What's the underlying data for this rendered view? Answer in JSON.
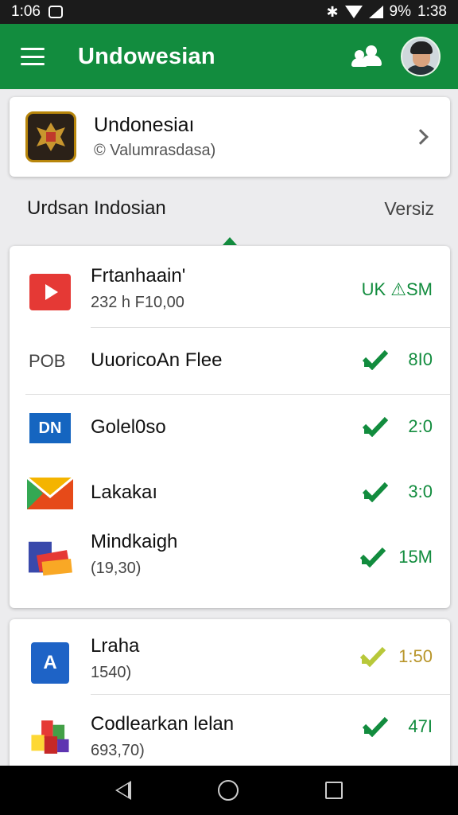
{
  "status_bar": {
    "left_text": "1:06",
    "battery": "9%",
    "time": "1:38"
  },
  "app_bar": {
    "title": "Undowesian",
    "menu_icon": "hamburger-icon",
    "people_icon": "people-icon"
  },
  "header_card": {
    "title": "Undonesiaı",
    "subtitle": "© Valumrasdasa)"
  },
  "section": {
    "title": "Urdsan Indosian",
    "action": "Versiz"
  },
  "list": [
    {
      "name": "Frtanhaain'",
      "meta": "232 h F10,00",
      "value": "UK ⚠SM",
      "icon": "play-icon",
      "checked": false
    },
    {
      "name": "UuoricoAn Flee",
      "meta": "",
      "value": "8I0",
      "icon_text": "POB",
      "checked": true
    },
    {
      "name": "Golel0so",
      "meta": "",
      "value": "2:0",
      "icon_text": "DN",
      "checked": true
    },
    {
      "name": "Lakakaı",
      "meta": "",
      "value": "3:0",
      "icon": "mail-icon",
      "checked": true
    },
    {
      "name": "Mindkaigh",
      "meta": "(19,30)",
      "value": "15M",
      "icon": "books-icon",
      "checked": true
    }
  ],
  "list2": [
    {
      "name": "Lraha",
      "meta": "1540)",
      "value": "1:50",
      "icon_text": "A",
      "checked": true,
      "check_color": "#b8c83a",
      "value_color": "#b8952a"
    },
    {
      "name": "Codlearkan lelan",
      "meta": "693,70)",
      "value": "47I",
      "icon": "apps-icon",
      "checked": true
    }
  ],
  "colors": {
    "brand": "#128c3e",
    "check": "#128c3e"
  }
}
